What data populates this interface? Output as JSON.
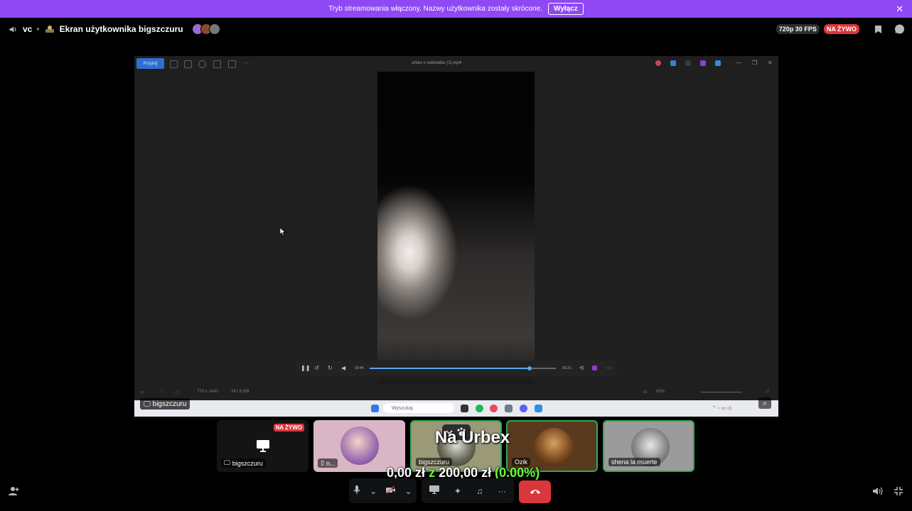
{
  "banner": {
    "text": "Tryb streamowania włączony. Nazwy użytkownika zostały skrócone.",
    "button": "Wyłącz",
    "close": "✕"
  },
  "header": {
    "channel": "vc",
    "separator": "•",
    "title": "Ekran użytkownika bigszczuru",
    "quality": "720p 30 FPS",
    "live": "NA ŻYWO"
  },
  "stream": {
    "edit_label": "Przytnij",
    "file_title": "urbex v ostkowiku (1).mp4",
    "time_current": "33:44",
    "time_total": "05:21",
    "progress": 0.86,
    "resolution": "720 x 1440",
    "filesize": "241.6 MB",
    "zoom": "65%",
    "search_placeholder": "Wyszukaj",
    "streamer": "bigszczuru"
  },
  "participants": [
    {
      "name": "bigszczuru",
      "badge": "NA ŻYWO"
    },
    {
      "name": "n..."
    },
    {
      "name": "bigszczuru"
    },
    {
      "name": "Ozik"
    },
    {
      "name": "shena la muerte"
    }
  ],
  "overlay": {
    "title": "Na Urbex",
    "current": "0,00 zł",
    "separator": "z",
    "goal": "200,00 zł",
    "percent": "(0.00%)"
  },
  "colors": {
    "banner": "#8f49f4",
    "live": "#da373c",
    "speaking": "#2fa84f",
    "accent_green": "#6bff3b"
  }
}
